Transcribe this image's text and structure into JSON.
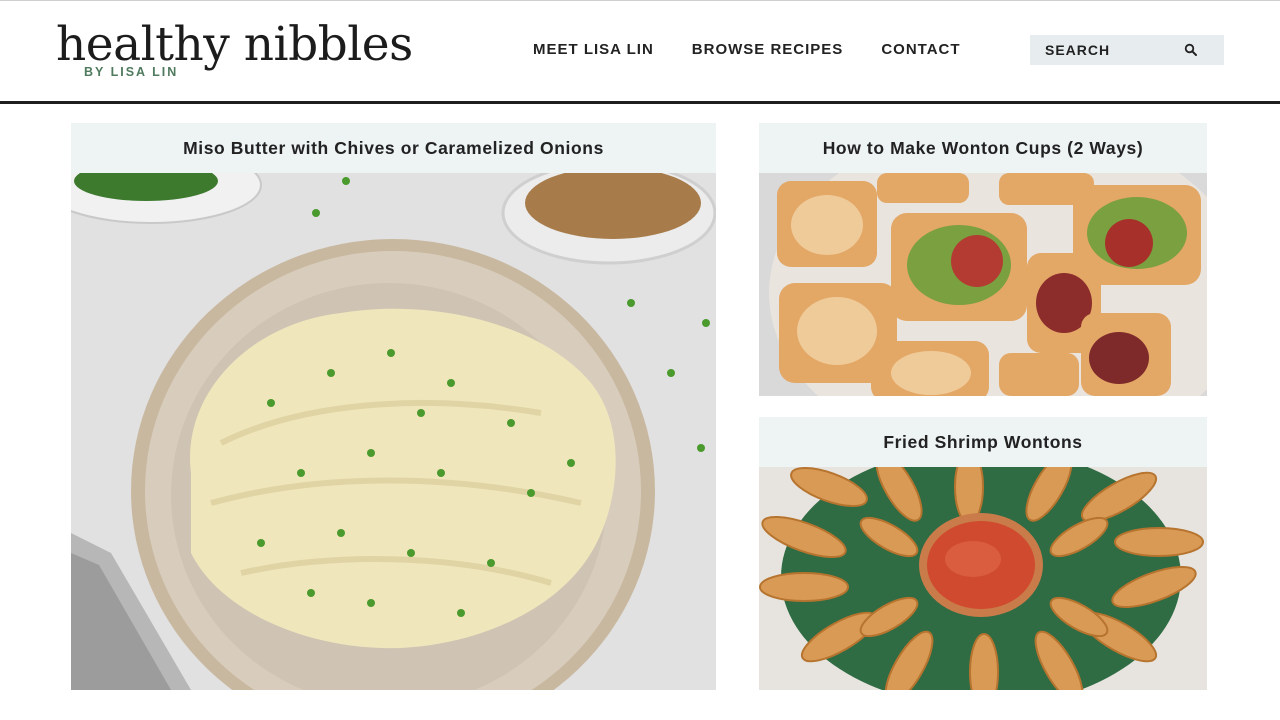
{
  "site": {
    "logo_main": "healthy nibbles",
    "logo_sub": "BY LISA LIN"
  },
  "nav": {
    "items": [
      {
        "label": "MEET LISA LIN"
      },
      {
        "label": "BROWSE RECIPES"
      },
      {
        "label": "CONTACT"
      }
    ]
  },
  "search": {
    "placeholder": "SEARCH",
    "icon": "magnifier-icon"
  },
  "cards": [
    {
      "title": "Miso Butter with Chives or Caramelized Onions",
      "image": "miso-butter-bowl-photo"
    },
    {
      "title": "How to Make Wonton Cups (2 Ways)",
      "image": "wonton-cups-plate-photo"
    },
    {
      "title": "Fried Shrimp Wontons",
      "image": "fried-shrimp-wontons-photo"
    }
  ],
  "colors": {
    "accent_green": "#4f7a5e",
    "card_background": "#eef3f3",
    "search_background": "#e7ecee",
    "header_rule": "#1f1f1f"
  }
}
